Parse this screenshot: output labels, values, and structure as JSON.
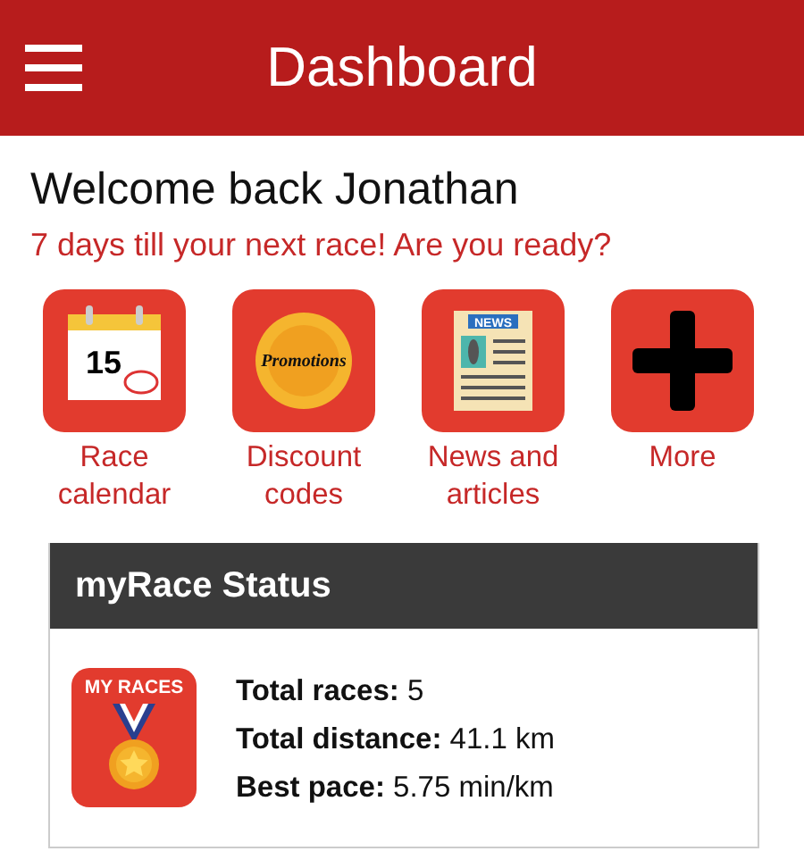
{
  "app_bar": {
    "title": "Dashboard"
  },
  "welcome": "Welcome back Jonathan",
  "countdown": "7 days till your next race! Are you ready?",
  "shortcuts": [
    {
      "kind": "calendar",
      "icon_text": "15",
      "label": "Race calendar"
    },
    {
      "kind": "promotions",
      "icon_text": "Promotions",
      "label": "Discount codes"
    },
    {
      "kind": "news",
      "icon_text": "NEWS",
      "label": "News and articles"
    },
    {
      "kind": "more",
      "label": "More"
    }
  ],
  "status_card": {
    "title": "myRace Status",
    "badge_text": "MY RACES",
    "stats": [
      "**Total races:** 5",
      "**Total distance:** 41.1 km",
      "**Best pace:** 5.75 min/km"
    ]
  }
}
